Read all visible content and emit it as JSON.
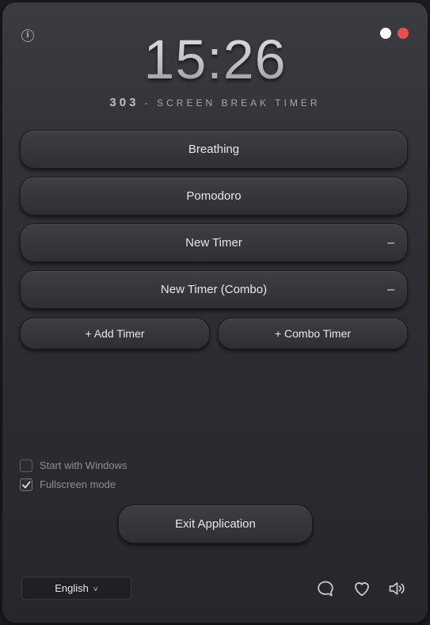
{
  "clock": {
    "time": "15:26"
  },
  "subtitle": {
    "number": "303",
    "separator": " - ",
    "text": "SCREEN BREAK TIMER"
  },
  "timers": [
    {
      "label": "Breathing",
      "removable": false
    },
    {
      "label": "Pomodoro",
      "removable": false
    },
    {
      "label": "New Timer",
      "removable": true
    },
    {
      "label": "New Timer (Combo)",
      "removable": true
    }
  ],
  "remove_symbol": "–",
  "actions": {
    "add_timer": "+ Add Timer",
    "combo_timer": "+ Combo Timer"
  },
  "settings": {
    "start_with_windows": {
      "label": "Start with Windows",
      "checked": false
    },
    "fullscreen_mode": {
      "label": "Fullscreen mode",
      "checked": true
    }
  },
  "exit_button": "Exit Application",
  "language": {
    "selected": "English",
    "chevron": "˅"
  },
  "info_glyph": "i",
  "colors": {
    "accent_red": "#ec4e4e",
    "dot_white": "#ffffff",
    "button_text": "#e6e7ea"
  }
}
